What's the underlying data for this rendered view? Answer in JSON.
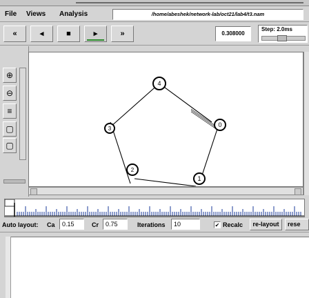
{
  "menu": {
    "file": "File",
    "views": "Views",
    "analysis": "Analysis",
    "filepath": "/home/abeshek/network-lab/oct21/lab4/t3.nam"
  },
  "toolbar": {
    "rewind": "«",
    "step_back": "◂",
    "stop": "■",
    "play": "▸",
    "fast_forward": "»",
    "time": "0.308000",
    "step_label": "Step: 2.0ms"
  },
  "nodes": [
    {
      "id": "0",
      "label": "0"
    },
    {
      "id": "1",
      "label": "1"
    },
    {
      "id": "2",
      "label": "2"
    },
    {
      "id": "3",
      "label": "3"
    },
    {
      "id": "4",
      "label": "4"
    }
  ],
  "autolayout": {
    "title": "Auto layout:",
    "ca_label": "Ca",
    "ca_value": "0.15",
    "cr_label": "Cr",
    "cr_value": "0.75",
    "iterations_label": "Iterations",
    "iterations_value": "10",
    "recalc_label": "Recalc",
    "recalc_checked": true,
    "relayout_label": "re-layout",
    "reset_label": "rese"
  },
  "colors": {
    "accent_green": "#2a8a2a"
  }
}
